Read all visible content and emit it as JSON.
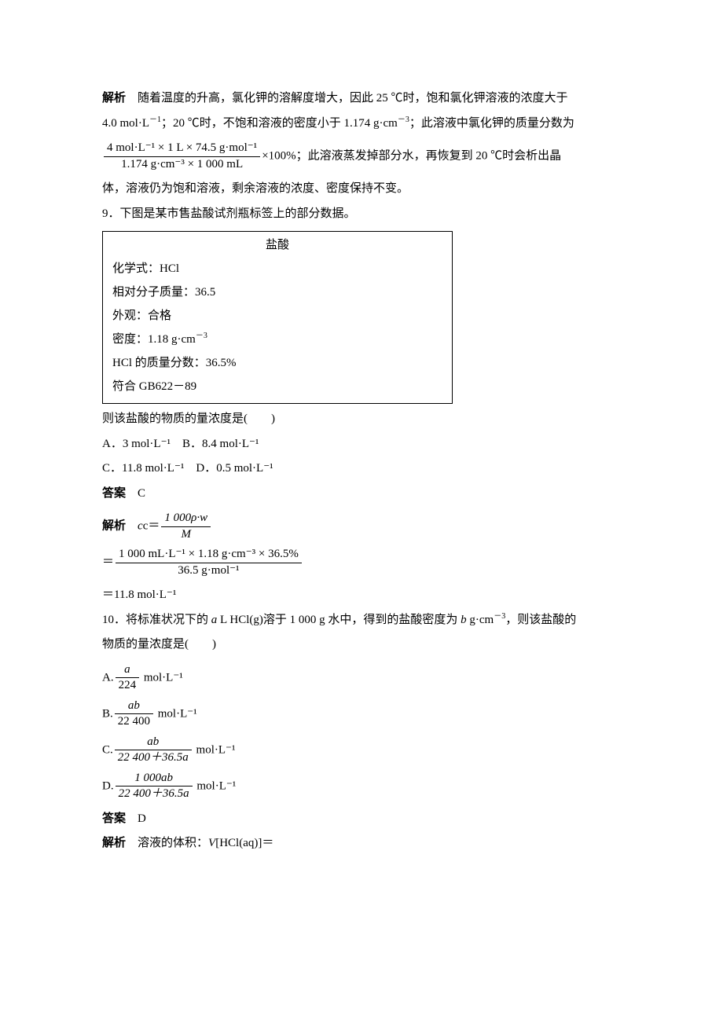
{
  "explain8_label": "解析",
  "explain8_text1": "　随着温度的升高，氯化钾的溶解度增大，因此 25 ℃时，饱和氯化钾溶液的浓度大于",
  "explain8_line2_a": "4.0 mol·L",
  "explain8_line2_b": "；20 ℃时，不饱和溶液的密度小于 1.174 g·cm",
  "explain8_line2_c": "；此溶液中氯化钾的质量分数为",
  "frac8_num": "4 mol·L⁻¹ × 1 L × 74.5 g·mol⁻¹",
  "frac8_den": "1.174 g·cm⁻³ × 1 000 mL",
  "frac8_after": "×100%；此溶液蒸发掉部分水，再恢复到 20 ℃时会析出晶",
  "explain8_line4": "体，溶液仍为饱和溶液，剩余溶液的浓度、密度保持不变。",
  "q9_stem": "9．下图是某市售盐酸试剂瓶标签上的部分数据。",
  "label_title": "盐酸",
  "label_l1": "化学式：HCl",
  "label_l2": "相对分子质量：36.5",
  "label_l3": "外观：合格",
  "label_l4_a": "密度：1.18 g·cm",
  "label_l5": "HCl 的质量分数：36.5%",
  "label_l6": "符合 GB622－89",
  "q9_ask": "则该盐酸的物质的量浓度是(　　)",
  "q9_A": "A．3 mol·L⁻¹",
  "q9_B": "B．8.4 mol·L⁻¹",
  "q9_C": "C．11.8 mol·L⁻¹",
  "q9_D": "D．0.5 mol·L⁻¹",
  "ans_label": "答案",
  "q9_ans": "　C",
  "expl_label": "解析",
  "q9_expl_pre": "　",
  "q9_expl_c_eq": "c＝",
  "q9_expl_frac_num": "1 000ρ·w",
  "q9_expl_frac_den": "M",
  "q9_eq2_num": "1 000 mL·L⁻¹ × 1.18 g·cm⁻³ × 36.5%",
  "q9_eq2_den": "36.5 g·mol⁻¹",
  "q9_eq3": "＝11.8 mol·L⁻¹",
  "q10_stem_a": "10．将标准状况下的 ",
  "q10_stem_b": " L HCl(g)溶于 1 000 g 水中，得到的盐酸密度为 ",
  "q10_stem_c": " g·cm",
  "q10_stem_d": "，则该盐酸的",
  "q10_stem_e": "物质的量浓度是(　　)",
  "q10_A_pre": "A.",
  "q10_A_num": "a",
  "q10_A_den": "224",
  "q10_unit": " mol·L⁻¹",
  "q10_B_pre": "B.",
  "q10_B_num": "ab",
  "q10_B_den": "22 400",
  "q10_C_pre": "C.",
  "q10_C_num": "ab",
  "q10_C_den": "22 400＋36.5a",
  "q10_D_pre": "D.",
  "q10_D_num": "1 000ab",
  "q10_D_den": "22 400＋36.5a",
  "q10_ans": "　D",
  "q10_expl": "　溶液的体积：",
  "q10_expl_v": "V",
  "q10_expl_tail": "[HCl(aq)]＝",
  "sup_neg1": "－1",
  "sup_neg3": "－3",
  "it_a": "a",
  "it_b": "b",
  "it_c": "c"
}
